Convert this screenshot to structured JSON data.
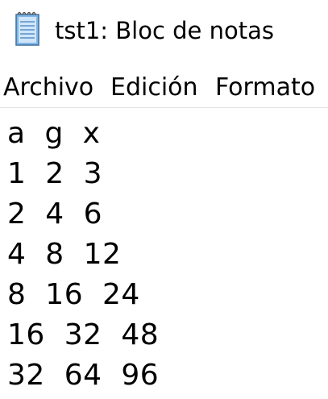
{
  "window": {
    "title": "tst1: Bloc de notas",
    "icon": "notepad-icon"
  },
  "menu": {
    "items": [
      "Archivo",
      "Edición",
      "Formato"
    ]
  },
  "editor": {
    "lines": [
      "a  g  x",
      "1  2  3",
      "2  4  6",
      "4  8  12",
      "8  16  24",
      "16  32  48",
      "32  64  96"
    ]
  }
}
